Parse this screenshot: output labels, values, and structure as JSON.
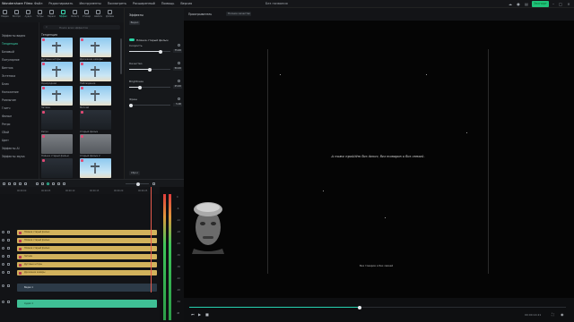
{
  "menubar": {
    "brand": "Wondershare Filmo",
    "menus": [
      "Файл",
      "Редактировать",
      "Инструменты",
      "Посмотреть",
      "Расширенный",
      "Помощь",
      "Версия"
    ],
    "doc_title": "Без названия",
    "export_label": "Экспорт"
  },
  "media_tabs": [
    {
      "label": "Медиа"
    },
    {
      "label": "Воспроизв"
    },
    {
      "label": "Аудио"
    },
    {
      "label": "Титры"
    },
    {
      "label": "Переходы"
    },
    {
      "label": "Эффекты"
    },
    {
      "label": "Фильтры"
    },
    {
      "label": "Стикеры"
    },
    {
      "label": "Шаблоны"
    },
    {
      "label": "Добавить"
    }
  ],
  "categories": [
    {
      "label": "Эффекты видео"
    },
    {
      "label": "Тенденция"
    },
    {
      "label": "Базовый"
    },
    {
      "label": "Популярное"
    },
    {
      "label": "Винтаж"
    },
    {
      "label": "Эстетика"
    },
    {
      "label": "Блик"
    },
    {
      "label": "Наложение"
    },
    {
      "label": "Размытие"
    },
    {
      "label": "Глитч"
    },
    {
      "label": "Фильм"
    },
    {
      "label": "Ретро"
    },
    {
      "label": "Сбой"
    },
    {
      "label": "Цвет"
    },
    {
      "label": "Эффекты AI"
    },
    {
      "label": "Эффекты звука"
    }
  ],
  "effects": {
    "search_placeholder": "Поиск всех эффектов",
    "section_title": "Тенденция",
    "items": [
      {
        "label": "Дуговые шторы",
        "style": "sky"
      },
      {
        "label": "Дрожание камеры",
        "style": "sky"
      },
      {
        "label": "Однородная",
        "style": "sky"
      },
      {
        "label": "Наблюдение",
        "style": "sky"
      },
      {
        "label": "Затемн",
        "style": "sky"
      },
      {
        "label": "Мягкий",
        "style": "sky"
      },
      {
        "label": "Ретро",
        "style": "dark"
      },
      {
        "label": "Старый фильм",
        "style": "dark"
      },
      {
        "label": "Плёнка старый фильм",
        "style": "grey"
      },
      {
        "label": "Старый фильм 2",
        "style": "grey"
      },
      {
        "label": "Старый",
        "style": "dark"
      },
      {
        "label": "Шум",
        "style": "sky"
      }
    ]
  },
  "props": {
    "panel_title": "Эффекты",
    "chip": "Видео",
    "effect_name": "Плёнка старый фильм",
    "params": [
      {
        "label": "Скорость",
        "value": "75.00",
        "fraction": 0.75
      },
      {
        "label": "Качество",
        "value": "50.00",
        "fraction": 0.5
      },
      {
        "label": "Brightness",
        "value": "25.00",
        "fraction": 0.25
      },
      {
        "label": "Фреш",
        "value": "5.00",
        "fraction": 0.05
      }
    ],
    "footer_button": "Сброс"
  },
  "preview": {
    "player_label": "Проигрыватель",
    "quality": "Полное качество",
    "quote": "А ниже пройдёт без денег, без товаров и без связей.",
    "credit": "Без товаров и без связей",
    "timecode": "00:00:14:21"
  },
  "timeline": {
    "ruler": [
      "00:00:00",
      "00:00:05",
      "00:00:10",
      "00:00:15",
      "00:00:20",
      "00:00:25",
      "00:00:30"
    ],
    "clips": [
      {
        "label": "Плёнка старый фильм",
        "kind": "gold",
        "width": 156
      },
      {
        "label": "Плёнка старый фильм",
        "kind": "gold",
        "width": 156
      },
      {
        "label": "Плёнка старый фильм",
        "kind": "gold",
        "width": 156
      },
      {
        "label": "Затемн",
        "kind": "gold",
        "width": 156
      },
      {
        "label": "Дуговые шторы",
        "kind": "gold",
        "width": 156
      },
      {
        "label": "Дрожание камеры",
        "kind": "gold",
        "width": 156
      },
      {
        "label": "Видео 1",
        "kind": "video",
        "width": 156
      },
      {
        "label": "Аудио 1",
        "kind": "audio",
        "width": 156
      }
    ],
    "meter_scale": [
      "0",
      "-6",
      "-12",
      "-18",
      "-24",
      "-30",
      "-36",
      "-42",
      "-48",
      "-54",
      "dB"
    ]
  }
}
